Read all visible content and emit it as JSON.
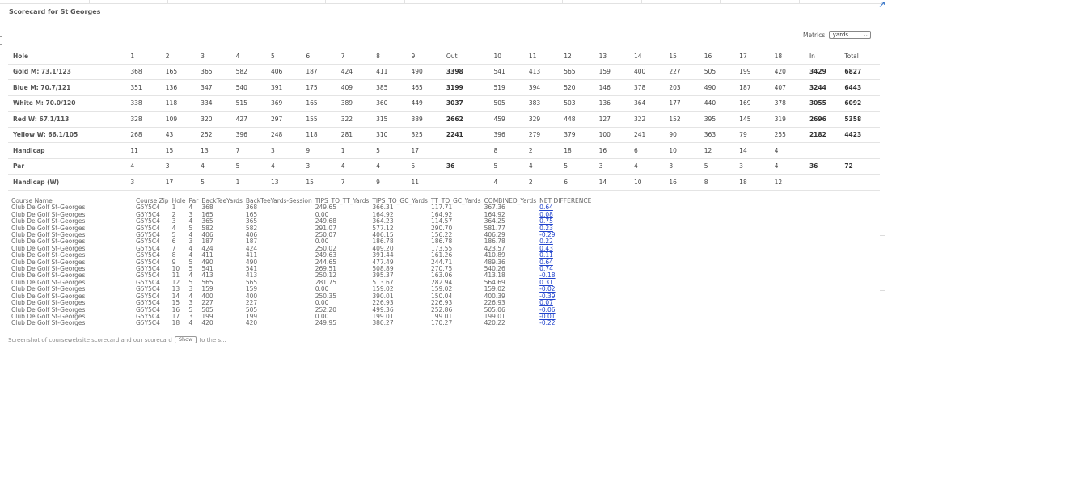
{
  "card": {
    "title": "Scorecard for St Georges",
    "metrics_label": "Metrics:",
    "metrics_value": "yards"
  },
  "scorecard": {
    "header": [
      "Hole",
      "1",
      "2",
      "3",
      "4",
      "5",
      "6",
      "7",
      "8",
      "9",
      "Out",
      "10",
      "11",
      "12",
      "13",
      "14",
      "15",
      "16",
      "17",
      "18",
      "In",
      "Total"
    ],
    "rows": [
      [
        "Gold M: 73.1/123",
        "368",
        "165",
        "365",
        "582",
        "406",
        "187",
        "424",
        "411",
        "490",
        "3398",
        "541",
        "413",
        "565",
        "159",
        "400",
        "227",
        "505",
        "199",
        "420",
        "3429",
        "6827"
      ],
      [
        "Blue M: 70.7/121",
        "351",
        "136",
        "347",
        "540",
        "391",
        "175",
        "409",
        "385",
        "465",
        "3199",
        "519",
        "394",
        "520",
        "146",
        "378",
        "203",
        "490",
        "187",
        "407",
        "3244",
        "6443"
      ],
      [
        "White M: 70.0/120",
        "338",
        "118",
        "334",
        "515",
        "369",
        "165",
        "389",
        "360",
        "449",
        "3037",
        "505",
        "383",
        "503",
        "136",
        "364",
        "177",
        "440",
        "169",
        "378",
        "3055",
        "6092"
      ],
      [
        "Red W: 67.1/113",
        "328",
        "109",
        "320",
        "427",
        "297",
        "155",
        "322",
        "315",
        "389",
        "2662",
        "459",
        "329",
        "448",
        "127",
        "322",
        "152",
        "395",
        "145",
        "319",
        "2696",
        "5358"
      ],
      [
        "Yellow W: 66.1/105",
        "268",
        "43",
        "252",
        "396",
        "248",
        "118",
        "281",
        "310",
        "325",
        "2241",
        "396",
        "279",
        "379",
        "100",
        "241",
        "90",
        "363",
        "79",
        "255",
        "2182",
        "4423"
      ],
      [
        "Handicap",
        "11",
        "15",
        "13",
        "7",
        "3",
        "9",
        "1",
        "5",
        "17",
        "",
        "8",
        "2",
        "18",
        "16",
        "6",
        "10",
        "12",
        "14",
        "4",
        "",
        ""
      ],
      [
        "Par",
        "4",
        "3",
        "4",
        "5",
        "4",
        "3",
        "4",
        "4",
        "5",
        "36",
        "5",
        "4",
        "5",
        "3",
        "4",
        "3",
        "5",
        "3",
        "4",
        "36",
        "72"
      ],
      [
        "Handicap (W)",
        "3",
        "17",
        "5",
        "1",
        "13",
        "15",
        "7",
        "9",
        "11",
        "",
        "4",
        "2",
        "6",
        "14",
        "10",
        "16",
        "8",
        "18",
        "12",
        "",
        ""
      ]
    ]
  },
  "raw_table": {
    "header": [
      "Course Name",
      "Course Zip",
      "Hole",
      "Par",
      "BackTeeYards",
      "BackTeeYards-Session",
      "TIPS_TO_TT_Yards",
      "TIPS_TO_GC_Yards",
      "TT_TO_GC_Yards",
      "COMBINED_Yards",
      "NET DIFFERENCE"
    ],
    "rows": [
      [
        "Club De Golf St-Georges",
        "G5Y5C4",
        "1",
        "4",
        "368",
        "368",
        "249.65",
        "366.31",
        "117.71",
        "367.36",
        "0.64"
      ],
      [
        "Club De Golf St-Georges",
        "G5Y5C4",
        "2",
        "3",
        "165",
        "165",
        "0.00",
        "164.92",
        "164.92",
        "164.92",
        "0.08"
      ],
      [
        "Club De Golf St-Georges",
        "G5Y5C4",
        "3",
        "4",
        "365",
        "365",
        "249.68",
        "364.23",
        "114.57",
        "364.25",
        "0.75"
      ],
      [
        "Club De Golf St-Georges",
        "G5Y5C4",
        "4",
        "5",
        "582",
        "582",
        "291.07",
        "577.12",
        "290.70",
        "581.77",
        "0.23"
      ],
      [
        "Club De Golf St-Georges",
        "G5Y5C4",
        "5",
        "4",
        "406",
        "406",
        "250.07",
        "406.15",
        "156.22",
        "406.29",
        "-0.29"
      ],
      [
        "Club De Golf St-Georges",
        "G5Y5C4",
        "6",
        "3",
        "187",
        "187",
        "0.00",
        "186.78",
        "186.78",
        "186.78",
        "0.22"
      ],
      [
        "Club De Golf St-Georges",
        "G5Y5C4",
        "7",
        "4",
        "424",
        "424",
        "250.02",
        "409.20",
        "173.55",
        "423.57",
        "0.43"
      ],
      [
        "Club De Golf St-Georges",
        "G5Y5C4",
        "8",
        "4",
        "411",
        "411",
        "249.63",
        "391.44",
        "161.26",
        "410.89",
        "0.11"
      ],
      [
        "Club De Golf St-Georges",
        "G5Y5C4",
        "9",
        "5",
        "490",
        "490",
        "244.65",
        "477.49",
        "244.71",
        "489.36",
        "0.64"
      ],
      [
        "Club De Golf St-Georges",
        "G5Y5C4",
        "10",
        "5",
        "541",
        "541",
        "269.51",
        "508.89",
        "270.75",
        "540.26",
        "0.74"
      ],
      [
        "Club De Golf St-Georges",
        "G5Y5C4",
        "11",
        "4",
        "413",
        "413",
        "250.12",
        "395.37",
        "163.06",
        "413.18",
        "-0.18"
      ],
      [
        "Club De Golf St-Georges",
        "G5Y5C4",
        "12",
        "5",
        "565",
        "565",
        "281.75",
        "513.67",
        "282.94",
        "564.69",
        "0.31"
      ],
      [
        "Club De Golf St-Georges",
        "G5Y5C4",
        "13",
        "3",
        "159",
        "159",
        "0.00",
        "159.02",
        "159.02",
        "159.02",
        "-0.02"
      ],
      [
        "Club De Golf St-Georges",
        "G5Y5C4",
        "14",
        "4",
        "400",
        "400",
        "250.35",
        "390.01",
        "150.04",
        "400.39",
        "-0.39"
      ],
      [
        "Club De Golf St-Georges",
        "G5Y5C4",
        "15",
        "3",
        "227",
        "227",
        "0.00",
        "226.93",
        "226.93",
        "226.93",
        "0.07"
      ],
      [
        "Club De Golf St-Georges",
        "G5Y5C4",
        "16",
        "5",
        "505",
        "505",
        "252.20",
        "499.36",
        "252.86",
        "505.06",
        "-0.06"
      ],
      [
        "Club De Golf St-Georges",
        "G5Y5C4",
        "17",
        "3",
        "199",
        "199",
        "0.00",
        "199.01",
        "199.01",
        "199.01",
        "-0.01"
      ],
      [
        "Club De Golf St-Georges",
        "G5Y5C4",
        "18",
        "4",
        "420",
        "420",
        "249.95",
        "380.27",
        "170.27",
        "420.22",
        "-0.22"
      ]
    ]
  },
  "footnote": {
    "text": "Screenshot of coursewebsite scorecard and our scorecard",
    "button_label": "Show",
    "text_after": "to the s..."
  }
}
